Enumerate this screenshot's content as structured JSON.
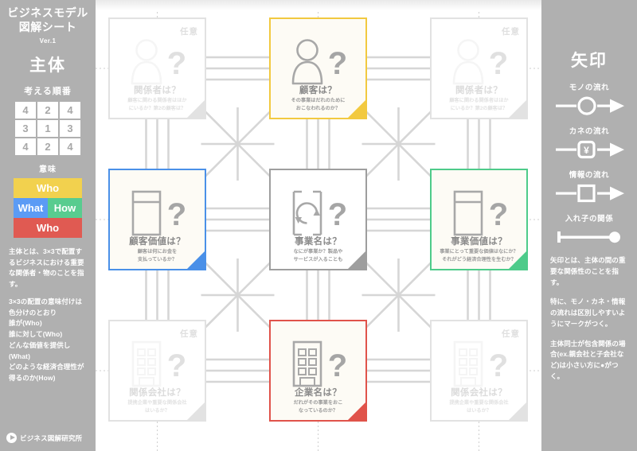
{
  "sidebar_left": {
    "title": "ビジネスモデル\n図解シート",
    "version": "Ver.1",
    "section_subject": "主体",
    "order_heading": "考える順番",
    "order_grid": [
      [
        4,
        2,
        4
      ],
      [
        3,
        1,
        3
      ],
      [
        4,
        2,
        4
      ]
    ],
    "meaning_heading": "意味",
    "legend": [
      [
        {
          "label": "Who",
          "color": "#f2d14e"
        }
      ],
      [
        {
          "label": "What",
          "color": "#5b9bf5"
        },
        {
          "label": "How",
          "color": "#58cc8f"
        }
      ],
      [
        {
          "label": "Who",
          "color": "#e05a52"
        }
      ]
    ],
    "paragraph_1": "主体とは、3×3で配置するビジネスにおける重要な関係者・物のことを指す。",
    "paragraph_2": "3×3の配置の意味付けは色分けのとおり\n誰が(Who)\n誰に対して(Who)\nどんな価値を提供し(What)\nどのような経済合理性が得るのか(How)",
    "brand": "ビジネス図解研究所"
  },
  "sidebar_right": {
    "section_arrow": "矢印",
    "arrows": [
      {
        "label": "モノの流れ",
        "marker": "circle",
        "icon_name": "mono-flow-arrow-icon"
      },
      {
        "label": "カネの流れ",
        "marker": "yen",
        "glyph": "¥",
        "icon_name": "kane-flow-arrow-icon"
      },
      {
        "label": "情報の流れ",
        "marker": "square",
        "icon_name": "joho-flow-arrow-icon"
      },
      {
        "label": "入れ子の関係",
        "marker": "nest",
        "icon_name": "nest-relation-icon"
      }
    ],
    "paragraph_1": "矢印とは、主体の間の重要な関係性のことを指す。",
    "paragraph_2": "特に、モノ・カネ・情報の流れは区別しやすいようにマークがつく。",
    "paragraph_3": "主体同士が包含関係の場合(ex.親会社と子会社など)は小さい方に●がつく。"
  },
  "canvas": {
    "optional_badge": "任意",
    "question_mark": "?",
    "cards": [
      {
        "key": "top-left",
        "title": "関係者は？",
        "subtitle": "顧客に関わる関係者はほか\nにいるか？第2の顧客は？",
        "icon": "person-icon",
        "optional": true,
        "state": "faded",
        "accent": "#e2e2e2"
      },
      {
        "key": "top-center",
        "title": "顧客は？",
        "subtitle": "その事業はだれのために\nおこなわれるのか？",
        "icon": "person-icon",
        "optional": false,
        "state": "strong",
        "accent": "#f2c940"
      },
      {
        "key": "top-right",
        "title": "関係者は？",
        "subtitle": "顧客に関わる関係者はほか\nにいるか？第2の顧客は？",
        "icon": "person-icon",
        "optional": true,
        "state": "faded",
        "accent": "#e2e2e2"
      },
      {
        "key": "mid-left",
        "title": "顧客価値は？",
        "subtitle": "顧客は何にお金を\n支払っているか？",
        "icon": "value-box-icon",
        "optional": false,
        "state": "strong",
        "accent": "#4a90e8"
      },
      {
        "key": "mid-center",
        "title": "事業名は？",
        "subtitle": "なにが事業か？製品や\nサービスが入ることも",
        "icon": "cycle-icon",
        "optional": false,
        "state": "strong",
        "accent": "#9e9e9e"
      },
      {
        "key": "mid-right",
        "title": "事業価値は？",
        "subtitle": "事業にとって重要な価値はなにか？\nそれがどう経済合理性を生むか？",
        "icon": "value-box-icon",
        "optional": false,
        "state": "strong",
        "accent": "#4ecb8a"
      },
      {
        "key": "bot-left",
        "title": "関係会社は？",
        "subtitle": "提携企業や重要な関係会社\nはいるか？",
        "icon": "building-icon",
        "optional": true,
        "state": "faded",
        "accent": "#e2e2e2"
      },
      {
        "key": "bot-center",
        "title": "企業名は？",
        "subtitle": "だれがその事業をおこ\nなっているのか？",
        "icon": "building-icon",
        "optional": false,
        "state": "strong",
        "accent": "#e0534a"
      },
      {
        "key": "bot-right",
        "title": "関係会社は？",
        "subtitle": "提携企業や重要な関係会社\nはいるか？",
        "icon": "building-icon",
        "optional": true,
        "state": "faded",
        "accent": "#e2e2e2"
      }
    ]
  }
}
